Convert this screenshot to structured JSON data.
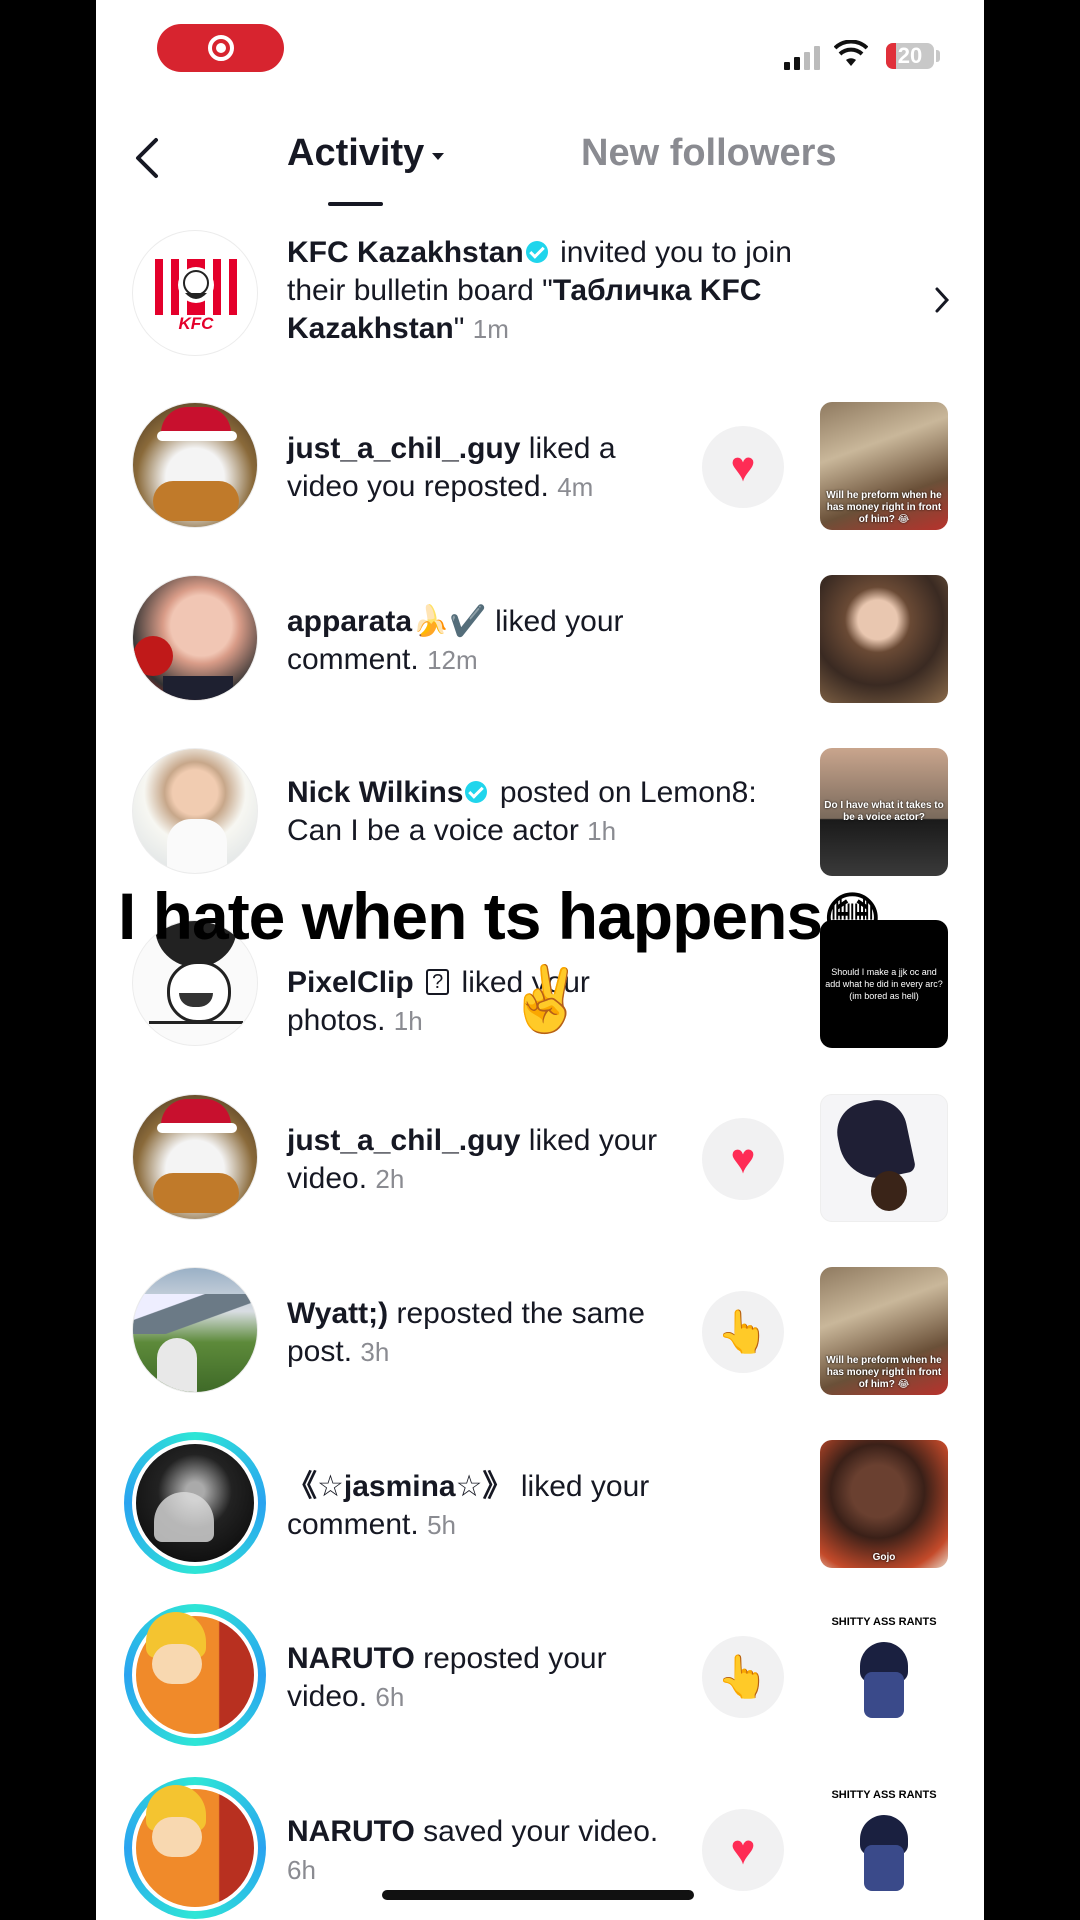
{
  "status_bar": {
    "battery": "20"
  },
  "header": {
    "tab_activity": "Activity",
    "tab_followers": "New followers"
  },
  "overlay": {
    "text": "I hate when ts happens",
    "emoji": "😳",
    "peace": "✌️"
  },
  "notifications": [
    {
      "user": "KFC Kazakhstan",
      "verified": true,
      "pre": "",
      "action": "invited you to join their bulletin board \"",
      "bold_tail": "Табличка KFC Kazakhstan",
      "post": "\"",
      "time": "1m"
    },
    {
      "user": "just_a_chil_.guy",
      "action": "liked a video you reposted.",
      "time": "4m",
      "reaction": "♥",
      "thumb_caption": "Will he preform when he has money right in front of him? 😂"
    },
    {
      "user": "apparata🍌✔️",
      "action": "liked your comment.",
      "time": "12m"
    },
    {
      "user": "Nick Wilkins",
      "verified": true,
      "action": "posted on Lemon8: Can I be a voice actor",
      "time": "1h",
      "thumb_caption": "Do I have what it takes to be a voice actor?"
    },
    {
      "user": "PixelClip",
      "badge": "?",
      "action": "liked your photos.",
      "time": "1h",
      "thumb_caption": "Should I make a jjk oc and add what he did in every arc? (im bored as hell)"
    },
    {
      "user": "just_a_chil_.guy",
      "action": "liked your video.",
      "time": "2h",
      "reaction": "♥"
    },
    {
      "user": "Wyatt;)",
      "action": "reposted the same post.",
      "time": "3h",
      "reaction": "👆",
      "thumb_caption": "Will he preform when he has money right in front of him? 😂"
    },
    {
      "user": "《☆jasmina☆》",
      "action": "liked your comment.",
      "time": "5h",
      "thumb_caption": "Gojo"
    },
    {
      "user": "NARUTO",
      "action": "reposted your video.",
      "time": "6h",
      "reaction": "👆",
      "thumb_caption": "SHITTY ASS RANTS"
    },
    {
      "user": "NARUTO",
      "action": "saved your video.",
      "time": "6h",
      "reaction": "♥",
      "thumb_caption": "SHITTY ASS RANTS"
    }
  ],
  "colors": {
    "like_red": "#fe2c55",
    "verified": "#20d5ec",
    "ring_start": "#2ee6d6",
    "ring_end": "#2aa3f0"
  }
}
